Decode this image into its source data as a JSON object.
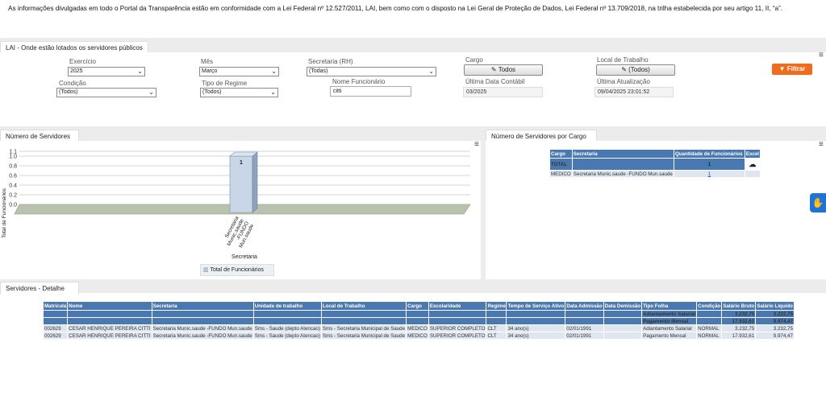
{
  "notice": "As informações divulgadas em todo o Portal da Transparência estão em conformidade com a Lei Federal nº 12.527/2011, LAI, bem como com o disposto na Lei Geral de Proteção de Dados, Lei Federal nº 13.709/2018, na trilha estabelecida por seu artigo 11, II, “a”.",
  "filter": {
    "tab_title": "LAI - Onde estão lotados os servidores públicos",
    "exercicio": {
      "label": "Exercício",
      "value": "2025"
    },
    "mes": {
      "label": "Mês",
      "value": "Março"
    },
    "secretaria": {
      "label": "Secretaria (RH)",
      "value": "(Todas)"
    },
    "cargo": {
      "label": "Cargo",
      "value": "Todos"
    },
    "local": {
      "label": "Local de Trabalho",
      "value": "(Todos)"
    },
    "condicao": {
      "label": "Condição",
      "value": "(Todos)"
    },
    "regime": {
      "label": "Tipo de Regime",
      "value": "(Todos)"
    },
    "funcionario": {
      "label": "Nome Funcionário",
      "value": "citti"
    },
    "ultima_data": {
      "label": "Última Data Contábil",
      "value": "03/2025"
    },
    "ultima_atualizacao": {
      "label": "Última Atualização",
      "value": "09/04/2025 23:01:52"
    },
    "filtrar_label": "Filtrar",
    "menu_icon": "menu-icon"
  },
  "chart_panel": {
    "tab_title": "Número de Servidores",
    "legend": "Total de Funcionários"
  },
  "chart_data": {
    "type": "bar",
    "categories": [
      "Secretaria Munic.saude -FUNDO Mun.saude"
    ],
    "series": [
      {
        "name": "Total de Funcionários",
        "values": [
          1
        ]
      }
    ],
    "data_labels": [
      "1"
    ],
    "xlabel": "Secretaria",
    "ylabel": "Total de Funcionários",
    "yticks": [
      "1.1",
      "1.0",
      "0.8",
      "0.6",
      "0.4",
      "0.2",
      "0.0"
    ],
    "ylim": [
      0,
      1.1
    ],
    "grid": true,
    "legend_placement": "bottom"
  },
  "cargo_panel": {
    "tab_title": "Número de Servidores por Cargo",
    "headers": [
      "Cargo",
      "Secretaria",
      "Quantidade de Funcionários",
      "Excel"
    ],
    "total_label": "TOTAL",
    "total_value": "1",
    "rows": [
      {
        "cargo": "MEDICO",
        "secretaria": "Secretaria Munic.saude -FUNDO Mun.saude",
        "quantidade": "1"
      }
    ]
  },
  "detail_panel": {
    "tab_title": "Servidores - Detalhe",
    "headers": [
      "Matrícula",
      "Nome",
      "Secretaria",
      "Unidade de trabalho",
      "Local de Trabalho",
      "Cargo",
      "Escolaridade",
      "Regime",
      "Tempo de Serviço Ativo",
      "Data Admissão",
      "Data Demissão",
      "Tipo Folha",
      "Condição",
      "Salário Bruto",
      "Salário Líquido"
    ],
    "totals": [
      {
        "tipo": "Adiantamento Salarial",
        "bruto": "3.232,75",
        "liquido": "3.232,75"
      },
      {
        "tipo": "Pagamento Mensal",
        "bruto": "17.932,61",
        "liquido": "9.974,47"
      }
    ],
    "rows": [
      [
        "002629",
        "CESAR HENRIQUE PEREIRA CITTI",
        "Secretaria Munic.saude -FUNDO Mun.saude",
        "Sms - Saude (depto Atencao)",
        "Sms - Secretaria Municipal de Saude",
        "MEDICO",
        "SUPERIOR COMPLETO",
        "CLT",
        "34 ano(s)",
        "02/01/1991",
        "",
        "Adiantamento Salarial",
        "NORMAL",
        "3.232,75",
        "3.232,75"
      ],
      [
        "002629",
        "CESAR HENRIQUE PEREIRA CITTI",
        "Secretaria Munic.saude -FUNDO Mun.saude",
        "Sms - Saude (depto Atencao)",
        "Sms - Secretaria Municipal de Saude",
        "MEDICO",
        "SUPERIOR COMPLETO",
        "CLT",
        "34 ano(s)",
        "02/01/1991",
        "",
        "Pagamento Mensal",
        "NORMAL",
        "17.932,61",
        "9.974,47"
      ]
    ]
  }
}
